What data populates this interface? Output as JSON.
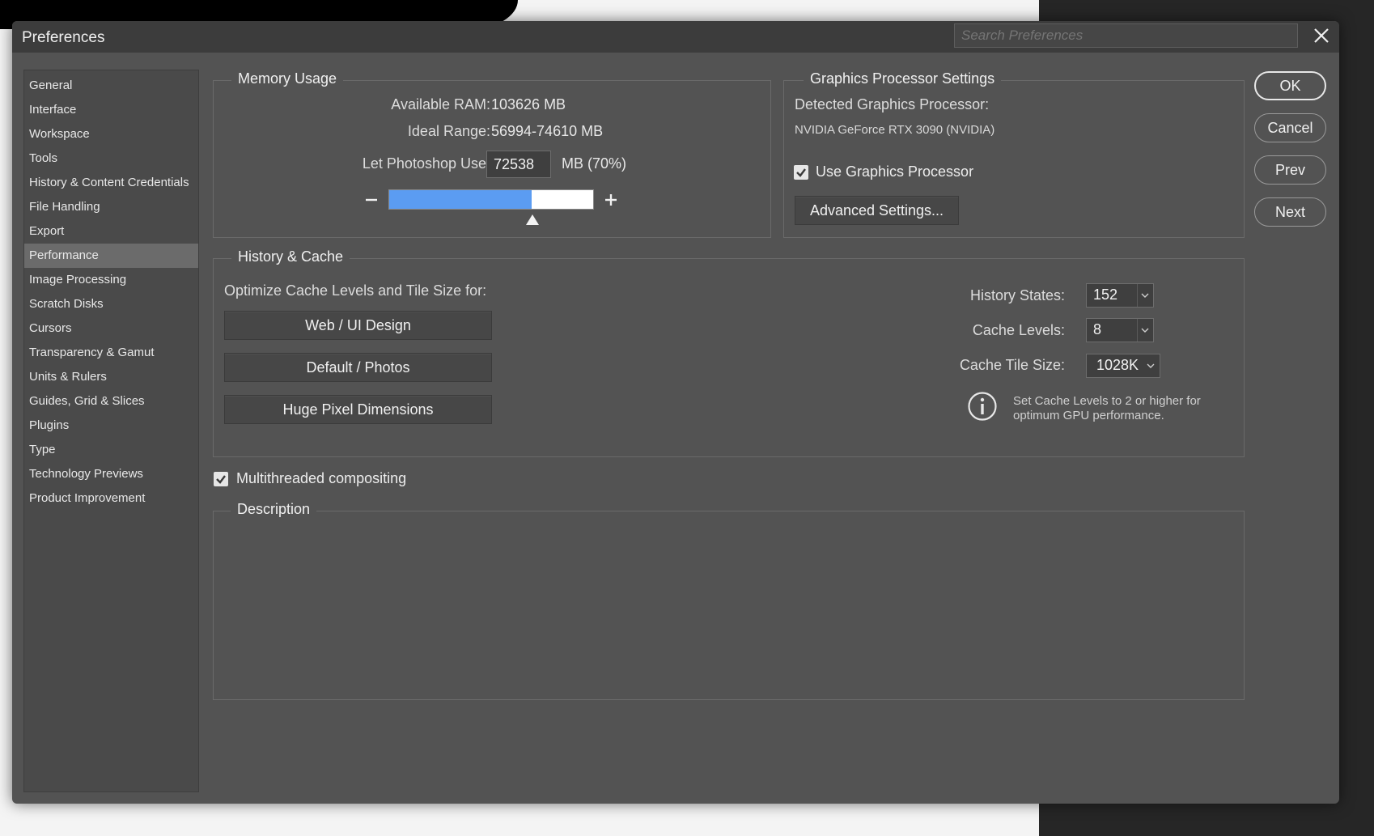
{
  "dialog": {
    "title": "Preferences",
    "search_placeholder": "Search Preferences"
  },
  "sidebar": {
    "items": [
      {
        "label": "General"
      },
      {
        "label": "Interface"
      },
      {
        "label": "Workspace"
      },
      {
        "label": "Tools"
      },
      {
        "label": "History & Content Credentials"
      },
      {
        "label": "File Handling"
      },
      {
        "label": "Export"
      },
      {
        "label": "Performance",
        "active": true
      },
      {
        "label": "Image Processing"
      },
      {
        "label": "Scratch Disks"
      },
      {
        "label": "Cursors"
      },
      {
        "label": "Transparency & Gamut"
      },
      {
        "label": "Units & Rulers"
      },
      {
        "label": "Guides, Grid & Slices"
      },
      {
        "label": "Plugins"
      },
      {
        "label": "Type"
      },
      {
        "label": "Technology Previews"
      },
      {
        "label": "Product Improvement"
      }
    ]
  },
  "memory": {
    "group_label": "Memory Usage",
    "available_label": "Available RAM:",
    "available_value": "103626 MB",
    "ideal_label": "Ideal Range:",
    "ideal_value": "56994-74610 MB",
    "use_label": "Let Photoshop Use:",
    "use_value": "72538",
    "use_unit": "MB (70%)",
    "slider_percent": 70
  },
  "gpu": {
    "group_label": "Graphics Processor Settings",
    "detected_label": "Detected Graphics Processor:",
    "detected_value": "NVIDIA GeForce RTX 3090 (NVIDIA)",
    "use_gpu_label": "Use Graphics Processor",
    "use_gpu_checked": true,
    "advanced_button": "Advanced Settings..."
  },
  "history_cache": {
    "group_label": "History & Cache",
    "optimize_label": "Optimize Cache Levels and Tile Size for:",
    "buttons": [
      "Web / UI Design",
      "Default / Photos",
      "Huge Pixel Dimensions"
    ],
    "history_states_label": "History States:",
    "history_states_value": "152",
    "cache_levels_label": "Cache Levels:",
    "cache_levels_value": "8",
    "cache_tile_label": "Cache Tile Size:",
    "cache_tile_value": "1028K",
    "info_line1": "Set Cache Levels to 2 or higher for",
    "info_line2": "optimum GPU performance."
  },
  "multithread": {
    "label": "Multithreaded compositing",
    "checked": true
  },
  "description": {
    "group_label": "Description"
  },
  "actions": {
    "ok": "OK",
    "cancel": "Cancel",
    "prev": "Prev",
    "next": "Next"
  }
}
